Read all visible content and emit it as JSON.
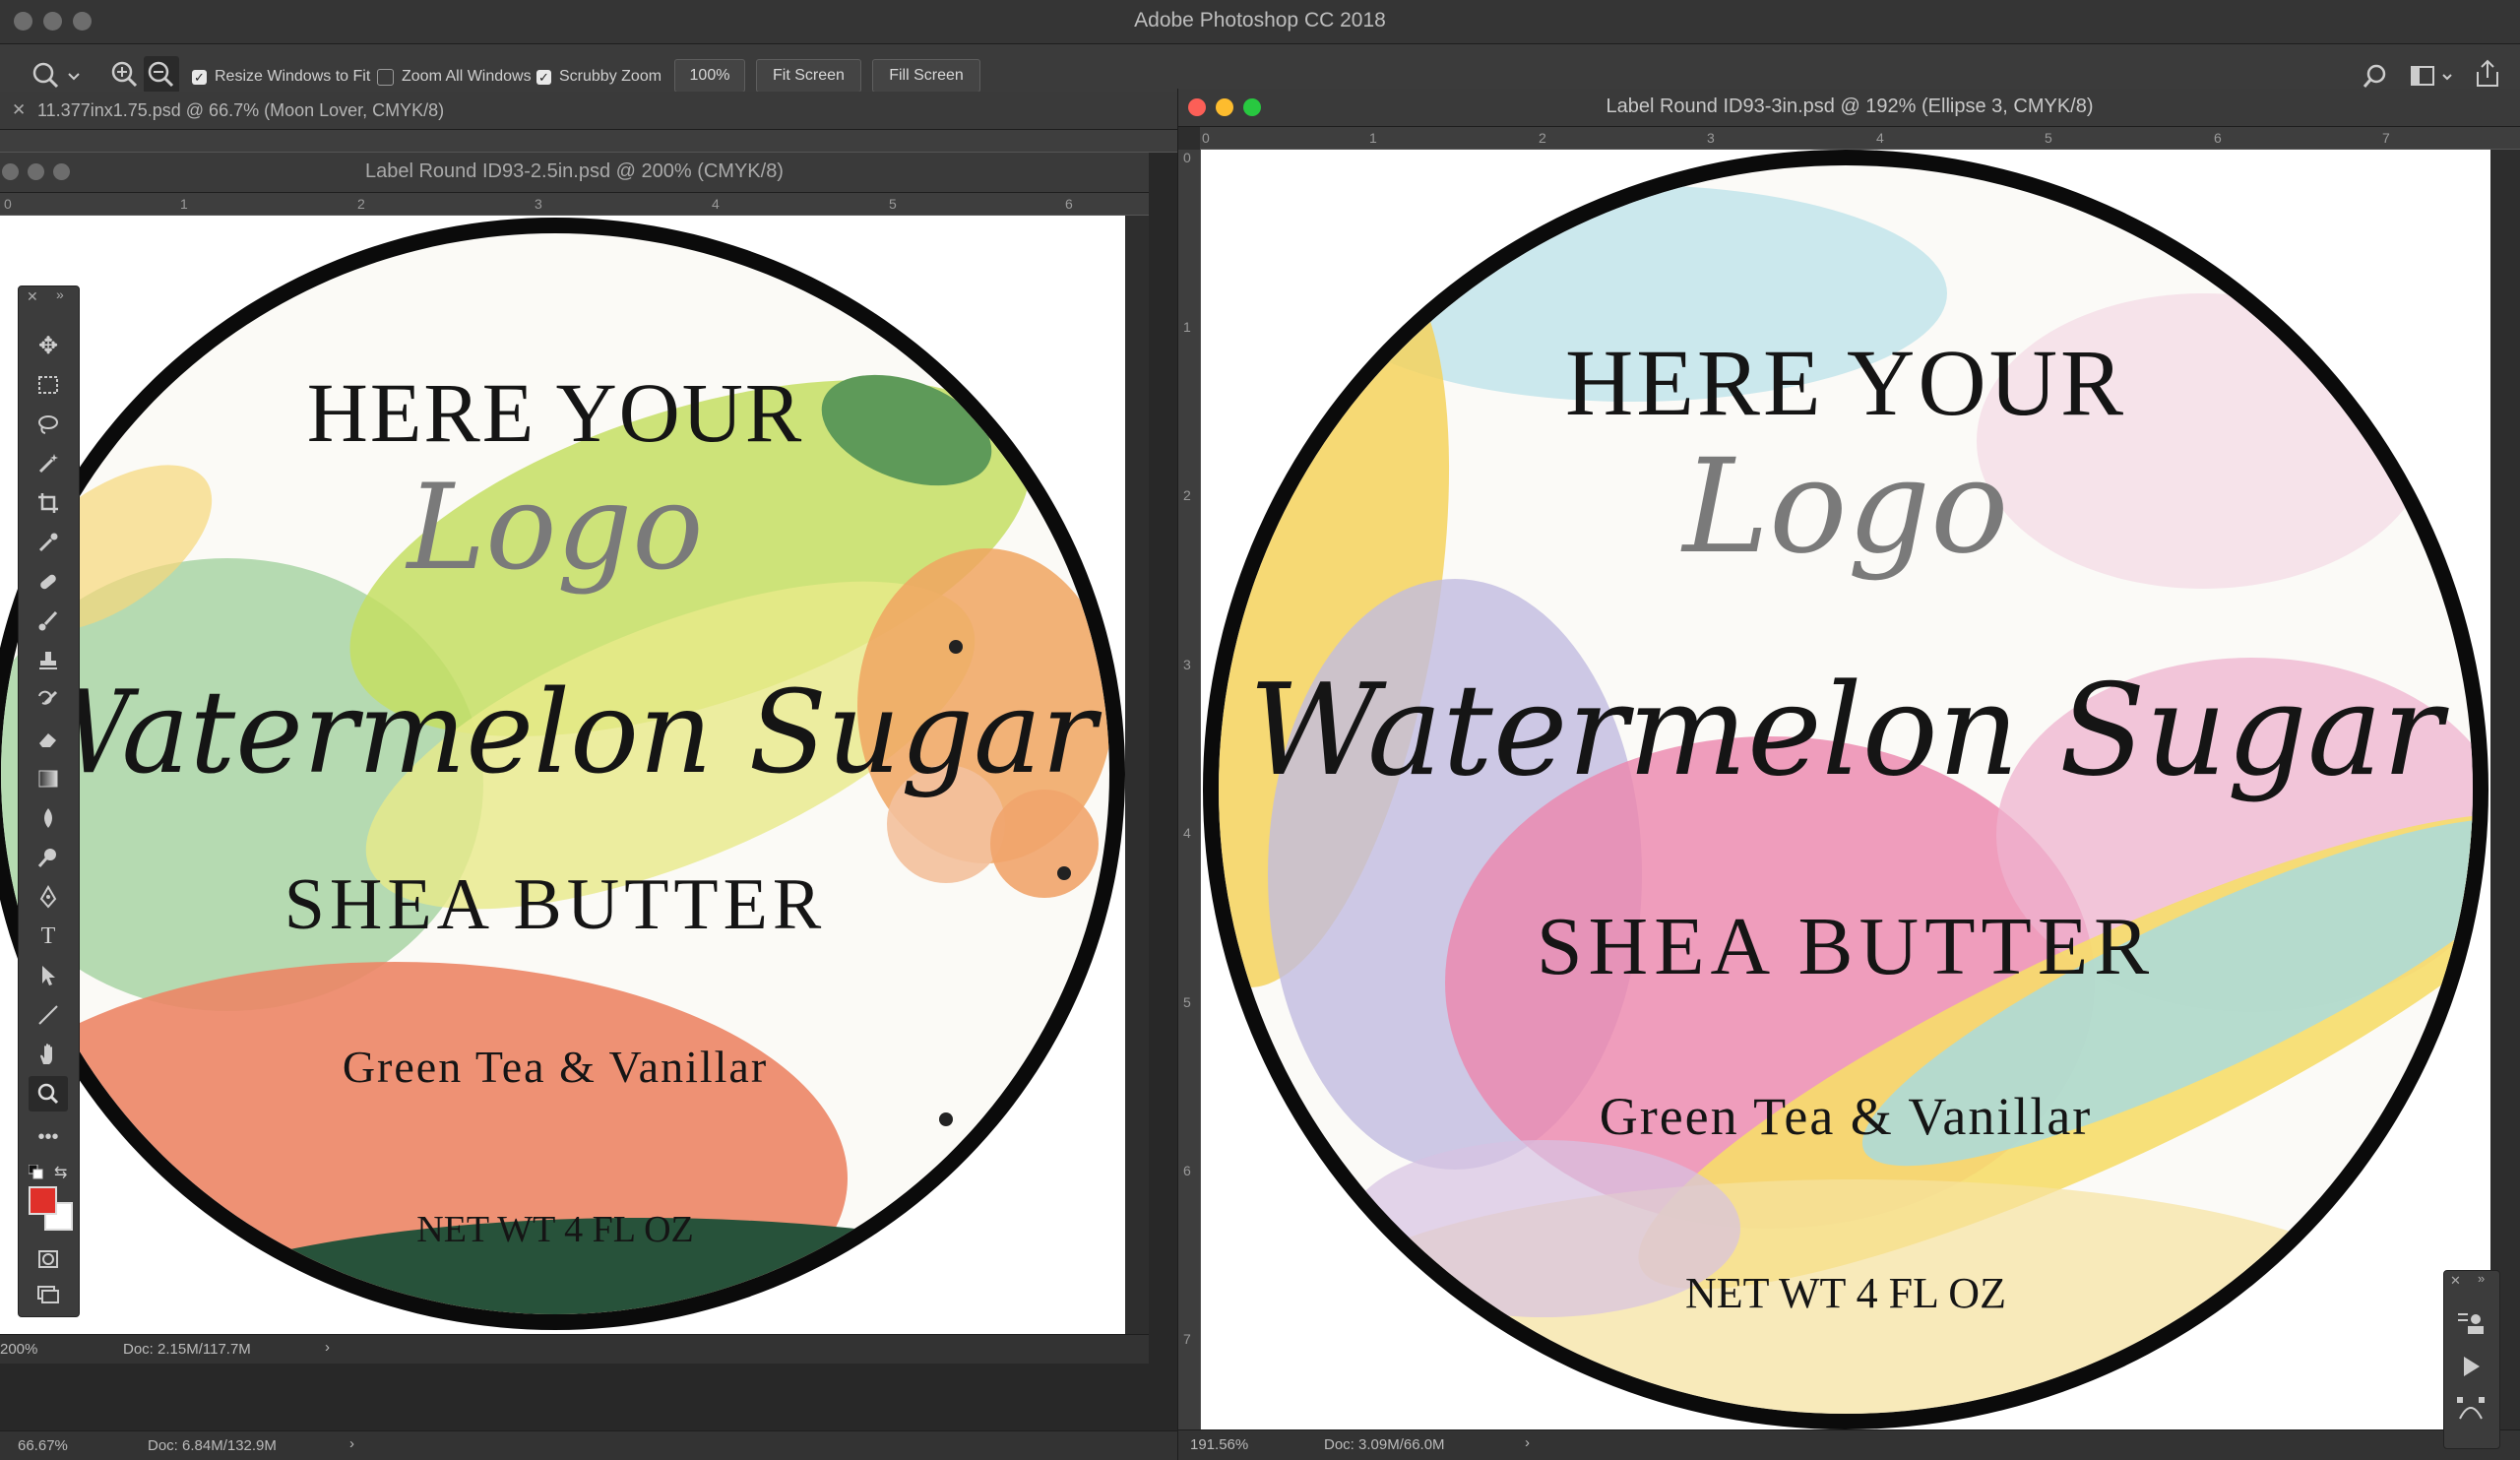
{
  "app": {
    "title": "Adobe Photoshop CC 2018"
  },
  "options": {
    "resize_windows": {
      "label": "Resize Windows to Fit",
      "checked": true
    },
    "zoom_all": {
      "label": "Zoom All Windows",
      "checked": false
    },
    "scrubby": {
      "label": "Scrubby Zoom",
      "checked": true
    },
    "zoom_value": "100%",
    "fit_screen": "Fit Screen",
    "fill_screen": "Fill Screen"
  },
  "windows": {
    "back": {
      "tab": "11.377inx1.75.psd @ 66.7% (Moon Lover, CMYK/8)",
      "zoom": "66.67%",
      "doc": "Doc: 6.84M/132.9M"
    },
    "left": {
      "title": "Label Round ID93-2.5in.psd @ 200% (CMYK/8)",
      "zoom": "200%",
      "doc": "Doc: 2.15M/117.7M"
    },
    "right": {
      "title": "Label Round ID93-3in.psd @ 192% (Ellipse 3, CMYK/8)",
      "zoom": "191.56%",
      "doc": "Doc: 3.09M/66.0M"
    }
  },
  "label": {
    "heading": "HERE YOUR",
    "logo": "Logo",
    "name": "Watermelon Sugar",
    "product": "SHEA BUTTER",
    "scent": "Green Tea & Vanillar",
    "net": "NET WT 4 FL OZ"
  },
  "rulers": {
    "left_h": [
      "0",
      "1",
      "2",
      "3",
      "4",
      "5",
      "6"
    ],
    "right_h": [
      "0",
      "1",
      "2",
      "3",
      "4",
      "5",
      "6",
      "7"
    ],
    "right_v": [
      "0",
      "1",
      "2",
      "3",
      "4",
      "5",
      "6",
      "7"
    ]
  },
  "colors": {
    "foreground": "#e0302a",
    "background": "#ffffff"
  }
}
